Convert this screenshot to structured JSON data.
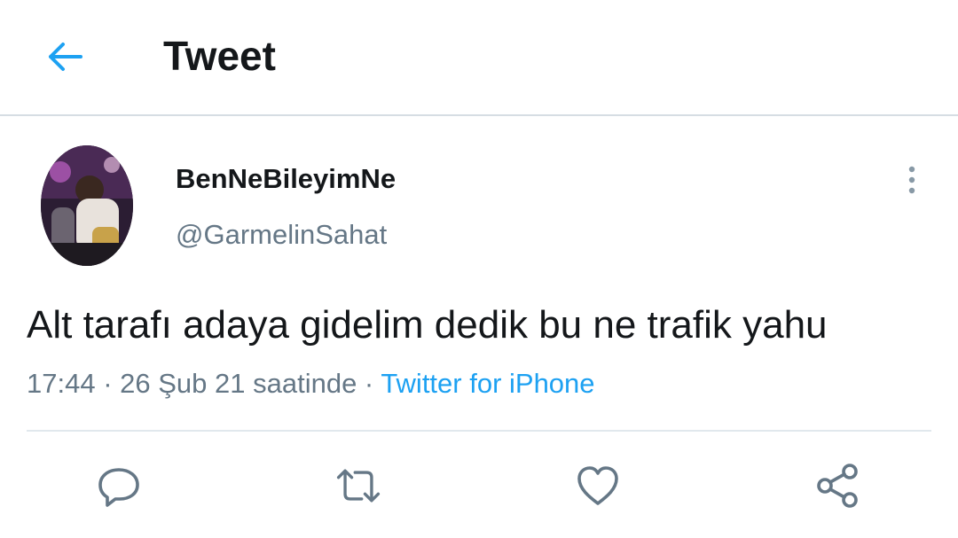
{
  "header": {
    "title": "Tweet",
    "back_icon": "arrow-left-icon"
  },
  "tweet": {
    "display_name": "BenNeBileyimNe",
    "handle": "@GarmelinSahat",
    "text": "Alt tarafı adaya gidelim dedik bu ne trafik yahu",
    "time": "17:44",
    "separator": " · ",
    "date": "26 Şub 21 saatinde",
    "source": "Twitter for iPhone"
  },
  "actions": [
    {
      "name": "reply",
      "icon": "reply-icon"
    },
    {
      "name": "retweet",
      "icon": "retweet-icon"
    },
    {
      "name": "like",
      "icon": "heart-icon"
    },
    {
      "name": "share",
      "icon": "share-icon"
    }
  ],
  "colors": {
    "accent": "#1da1f2",
    "text_primary": "#14171a",
    "text_secondary": "#657786",
    "divider": "#e1e8ed"
  }
}
